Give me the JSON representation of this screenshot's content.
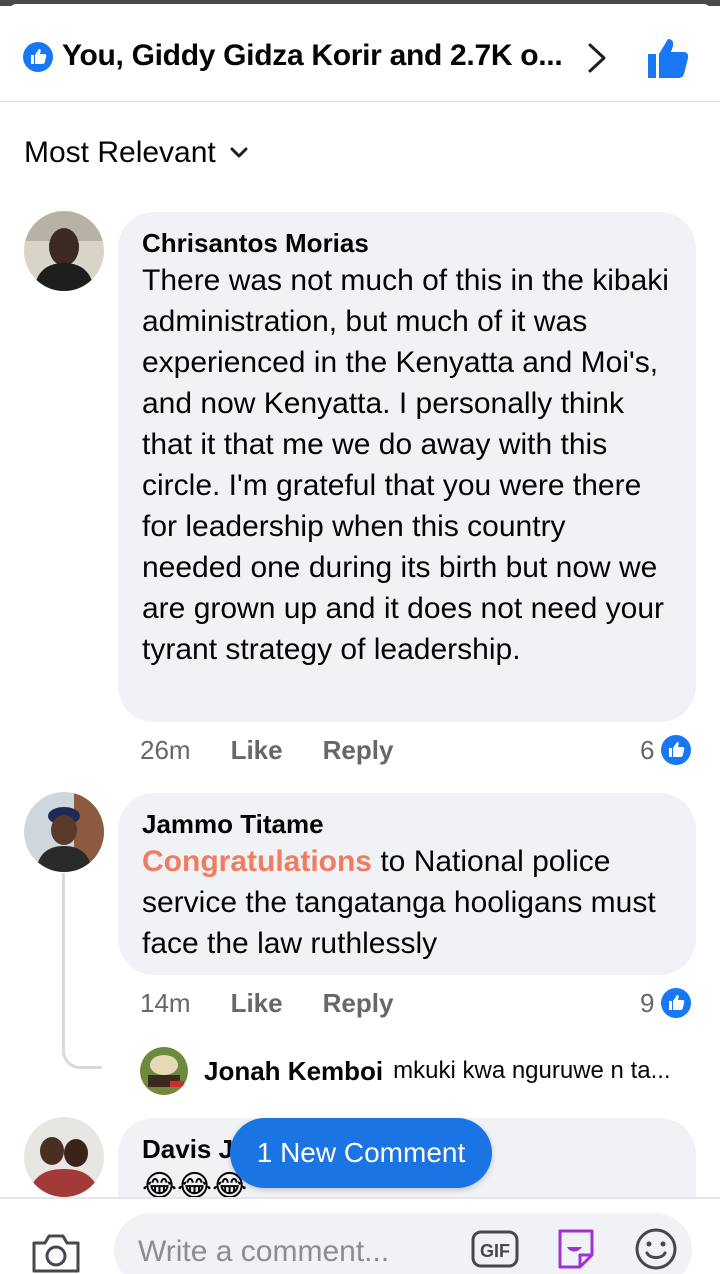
{
  "header": {
    "reactions_text": "You, Giddy Gidza Korir and 2.7K o...",
    "colors": {
      "blue": "#1877f2",
      "text": "#050505"
    }
  },
  "sort": {
    "label": "Most Relevant"
  },
  "comments": [
    {
      "name": "Chrisantos Morias",
      "text": "There was not much of this in the kibaki administration, but much of it was experienced in the Kenyatta and Moi's, and now Kenyatta. I personally think that it that me we do away with this circle. I'm grateful that you were there for leadership when this country needed one during its birth but now we are grown up and it does not need your tyrant strategy of leadership.",
      "time": "26m",
      "like_label": "Like",
      "reply_label": "Reply",
      "reaction_count": "6"
    },
    {
      "name": "Jammo Titame",
      "text_highlight": "Congratulations",
      "text_rest": " to National police service the tangatanga hooligans must face the law ruthlessly",
      "time": "14m",
      "like_label": "Like",
      "reply_label": "Reply",
      "reaction_count": "9",
      "reply_preview": {
        "name": "Jonah Kemboi",
        "text": "mkuki kwa nguruwe n ta..."
      }
    },
    {
      "name": "Davis J",
      "text": "😂😂😂"
    }
  ],
  "new_comment_button": {
    "label": "1 New Comment"
  },
  "composer": {
    "placeholder": "Write a comment...",
    "gif_label": "GIF",
    "icons": [
      "camera-icon",
      "gif-icon",
      "sticker-icon",
      "emoji-icon"
    ]
  }
}
